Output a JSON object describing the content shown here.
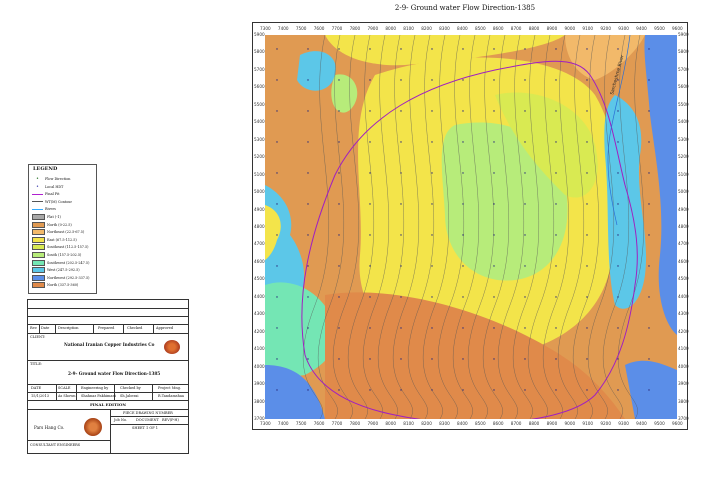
{
  "map": {
    "title": "2-9- Ground water Flow Direction-1385",
    "x_ticks": [
      "7300",
      "7400",
      "7500",
      "7600",
      "7700",
      "7800",
      "7900",
      "8000",
      "8100",
      "8200",
      "8300",
      "8400",
      "8500",
      "8600",
      "8700",
      "8800",
      "8900",
      "9000",
      "9100",
      "9200",
      "9300",
      "9400",
      "9500",
      "9600"
    ],
    "y_ticks": [
      "5900",
      "5800",
      "5700",
      "5600",
      "5500",
      "5400",
      "5300",
      "5200",
      "5100",
      "5000",
      "4900",
      "4800",
      "4700",
      "4600",
      "4500",
      "4400",
      "4300",
      "4200",
      "4100",
      "4000",
      "3900",
      "3800",
      "3700"
    ],
    "river_label": "Sarcheshme River",
    "colors": {
      "flat": "#a8a8a8",
      "north_0_22": "#e09a52",
      "northeast": "#f2b96a",
      "east": "#f3e44a",
      "southeast": "#d9ea52",
      "south": "#b7ec7a",
      "southwest": "#74e6b4",
      "west": "#5cc7e8",
      "northwest": "#5b8ee8",
      "north_337_360": "#e08a4a",
      "pit_outline": "#a020c0",
      "contour": "#555555"
    }
  },
  "legend": {
    "title": "LEGEND",
    "items": [
      {
        "label": "Flow Direction",
        "kind": "dot",
        "color": "#1a6a1a"
      },
      {
        "label": "Local HDT",
        "kind": "dot",
        "color": "#3333aa"
      },
      {
        "label": "Final Pit",
        "kind": "line",
        "color": "#b020d0"
      },
      {
        "label": "WT(M) Contour",
        "kind": "line",
        "color": "#555555"
      },
      {
        "label": "Rivers",
        "kind": "line",
        "color": "#33aaff"
      },
      {
        "label": "Flat (-1)",
        "kind": "swatch",
        "color": "#a8a8a8"
      },
      {
        "label": "North (0-22.5)",
        "kind": "swatch",
        "color": "#e09a52"
      },
      {
        "label": "Northeast (22.5-67.5)",
        "kind": "swatch",
        "color": "#f2b96a"
      },
      {
        "label": "East (67.5-112.5)",
        "kind": "swatch",
        "color": "#f3e44a"
      },
      {
        "label": "Southeast (112.5-157.5)",
        "kind": "swatch",
        "color": "#d9ea52"
      },
      {
        "label": "South (157.5-202.5)",
        "kind": "swatch",
        "color": "#b7ec7a"
      },
      {
        "label": "Southwest (202.5-247.5)",
        "kind": "swatch",
        "color": "#74e6b4"
      },
      {
        "label": "West (247.5-292.5)",
        "kind": "swatch",
        "color": "#5cc7e8"
      },
      {
        "label": "Northwest (292.5-337.5)",
        "kind": "swatch",
        "color": "#5b8ee8"
      },
      {
        "label": "North (337.5-360)",
        "kind": "swatch",
        "color": "#e08a4a"
      }
    ]
  },
  "title_block": {
    "rev_headers": [
      "Rev.",
      "Date",
      "Description",
      "Prepared",
      "Checked",
      "Approved"
    ],
    "client_label": "CLIENT:",
    "client_name": "National Iranian Copper Industries Co",
    "title_label": "TITLE:",
    "drawing_title": "2-9- Ground water Flow Direction-1385",
    "sign_headers": [
      "DATE",
      "SCALE",
      "Engineering by",
      "Checked by",
      "Project Mng."
    ],
    "sign_values": [
      "15/1/2013",
      "As Shown",
      "Shahnaz Fakhimani",
      "Sh.Jaberai",
      "R.Tandamshaa"
    ],
    "edition": "FINAL EDITION",
    "consultant_name": "Pars Hang Co.",
    "consultant_label": "CONSULTANT ENGINEERS",
    "piece_label": "PIECE DRAWING NUMBER",
    "piece_cells": [
      "Job No.",
      "DOCUMENT",
      "REV(P-H)"
    ],
    "sheet": "SHEET 1 OF 1"
  }
}
